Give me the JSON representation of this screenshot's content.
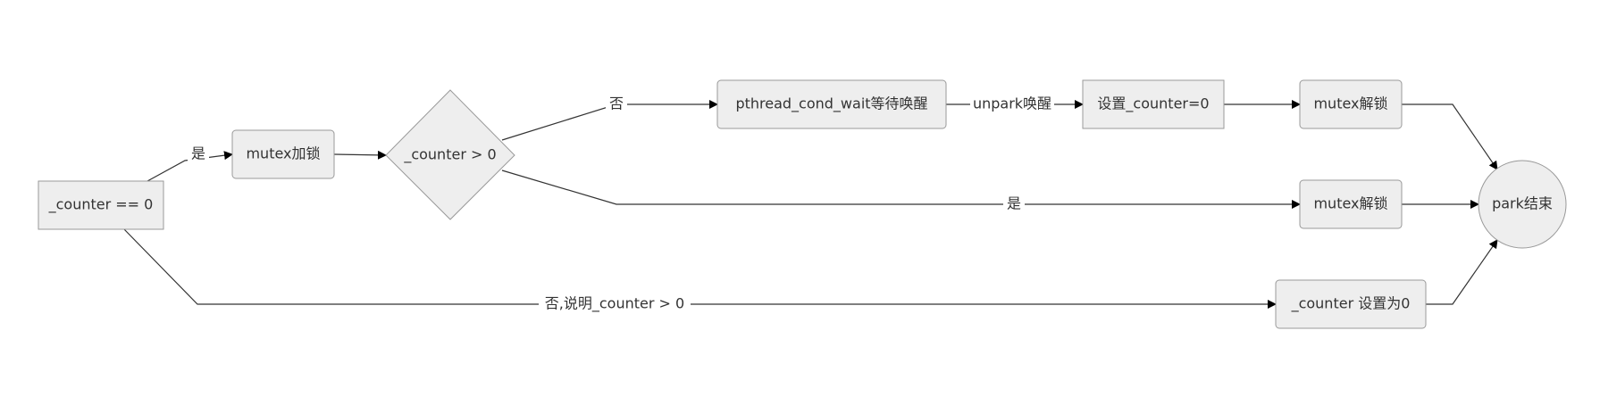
{
  "nodes": {
    "start": "_counter == 0",
    "lock": "mutex加锁",
    "decision": "_counter > 0",
    "wait": "pthread_cond_wait等待唤醒",
    "set_zero": "设置_counter=0",
    "unlock_top": "mutex解锁",
    "unlock_mid": "mutex解锁",
    "reset_counter": "_counter 设置为0",
    "end": "park结束"
  },
  "edges": {
    "start_to_lock": "是",
    "decision_no": "否",
    "wait_to_set": "unpark唤醒",
    "decision_yes": "是",
    "start_no": "否,说明_counter > 0"
  }
}
